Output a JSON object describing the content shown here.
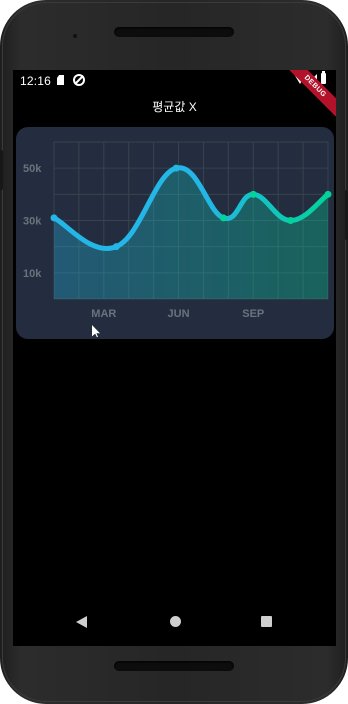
{
  "status_bar": {
    "time": "12:16",
    "icons": [
      "sd-card-icon",
      "sync-icon",
      "wifi-icon",
      "signal-icon",
      "battery-icon"
    ]
  },
  "debug_banner": "DEBUG",
  "app_bar": {
    "title": "평균값 X"
  },
  "colors": {
    "card_background": "#232d3f",
    "line_start": "#23b6e6",
    "line_end": "#02d39a",
    "grid": "#37434d",
    "axis_label": "#68737d"
  },
  "chart_data": {
    "type": "line",
    "curved": true,
    "x": [
      0,
      2.5,
      4.9,
      6.8,
      8,
      9.5,
      11
    ],
    "values": [
      3.1,
      2,
      5,
      3.1,
      4,
      3,
      4
    ],
    "xlim": [
      0,
      11
    ],
    "ylim": [
      0,
      6
    ],
    "x_tick_labels": [
      {
        "x": 2,
        "label": "MAR"
      },
      {
        "x": 5,
        "label": "JUN"
      },
      {
        "x": 8,
        "label": "SEP"
      }
    ],
    "y_tick_labels": [
      {
        "y": 1,
        "label": "10k"
      },
      {
        "y": 3,
        "label": "30k"
      },
      {
        "y": 5,
        "label": "50k"
      }
    ],
    "grid": true,
    "area_fill": true
  },
  "nav_bar": {
    "buttons": [
      "back-button",
      "home-button",
      "recents-button"
    ]
  }
}
